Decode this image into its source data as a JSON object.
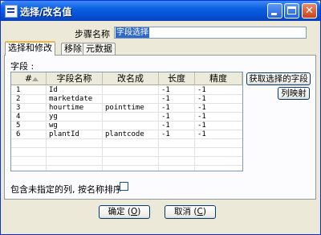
{
  "window": {
    "title": "选择/改名值"
  },
  "step": {
    "label": "步骤名称",
    "value": "字段选择"
  },
  "tabs": [
    {
      "label": "选择和修改"
    },
    {
      "label": "移除"
    },
    {
      "label": "元数据"
    }
  ],
  "fields": {
    "label": "字段 :",
    "columns": [
      "#",
      "字段名称",
      "改名成",
      "长度",
      "精度"
    ],
    "rows": [
      [
        "1",
        "Id",
        "",
        "-1",
        "-1"
      ],
      [
        "2",
        "marketdate",
        "",
        "-1",
        "-1"
      ],
      [
        "3",
        "hourtime",
        "pointtime",
        "-1",
        "-1"
      ],
      [
        "4",
        "yg",
        "",
        "-1",
        "-1"
      ],
      [
        "5",
        "wg",
        "",
        "-1",
        "-1"
      ],
      [
        "6",
        "plantId",
        "plantcode",
        "-1",
        "-1"
      ]
    ]
  },
  "side_buttons": {
    "get_fields": "获取选择的字段",
    "map": "列映射"
  },
  "include_unspecified": {
    "label": "包含未指定的列, 按名称排序",
    "checked": false
  },
  "footer": {
    "ok": {
      "label": "确定",
      "key": "O"
    },
    "cancel": {
      "label": "取消",
      "key": "C"
    }
  }
}
